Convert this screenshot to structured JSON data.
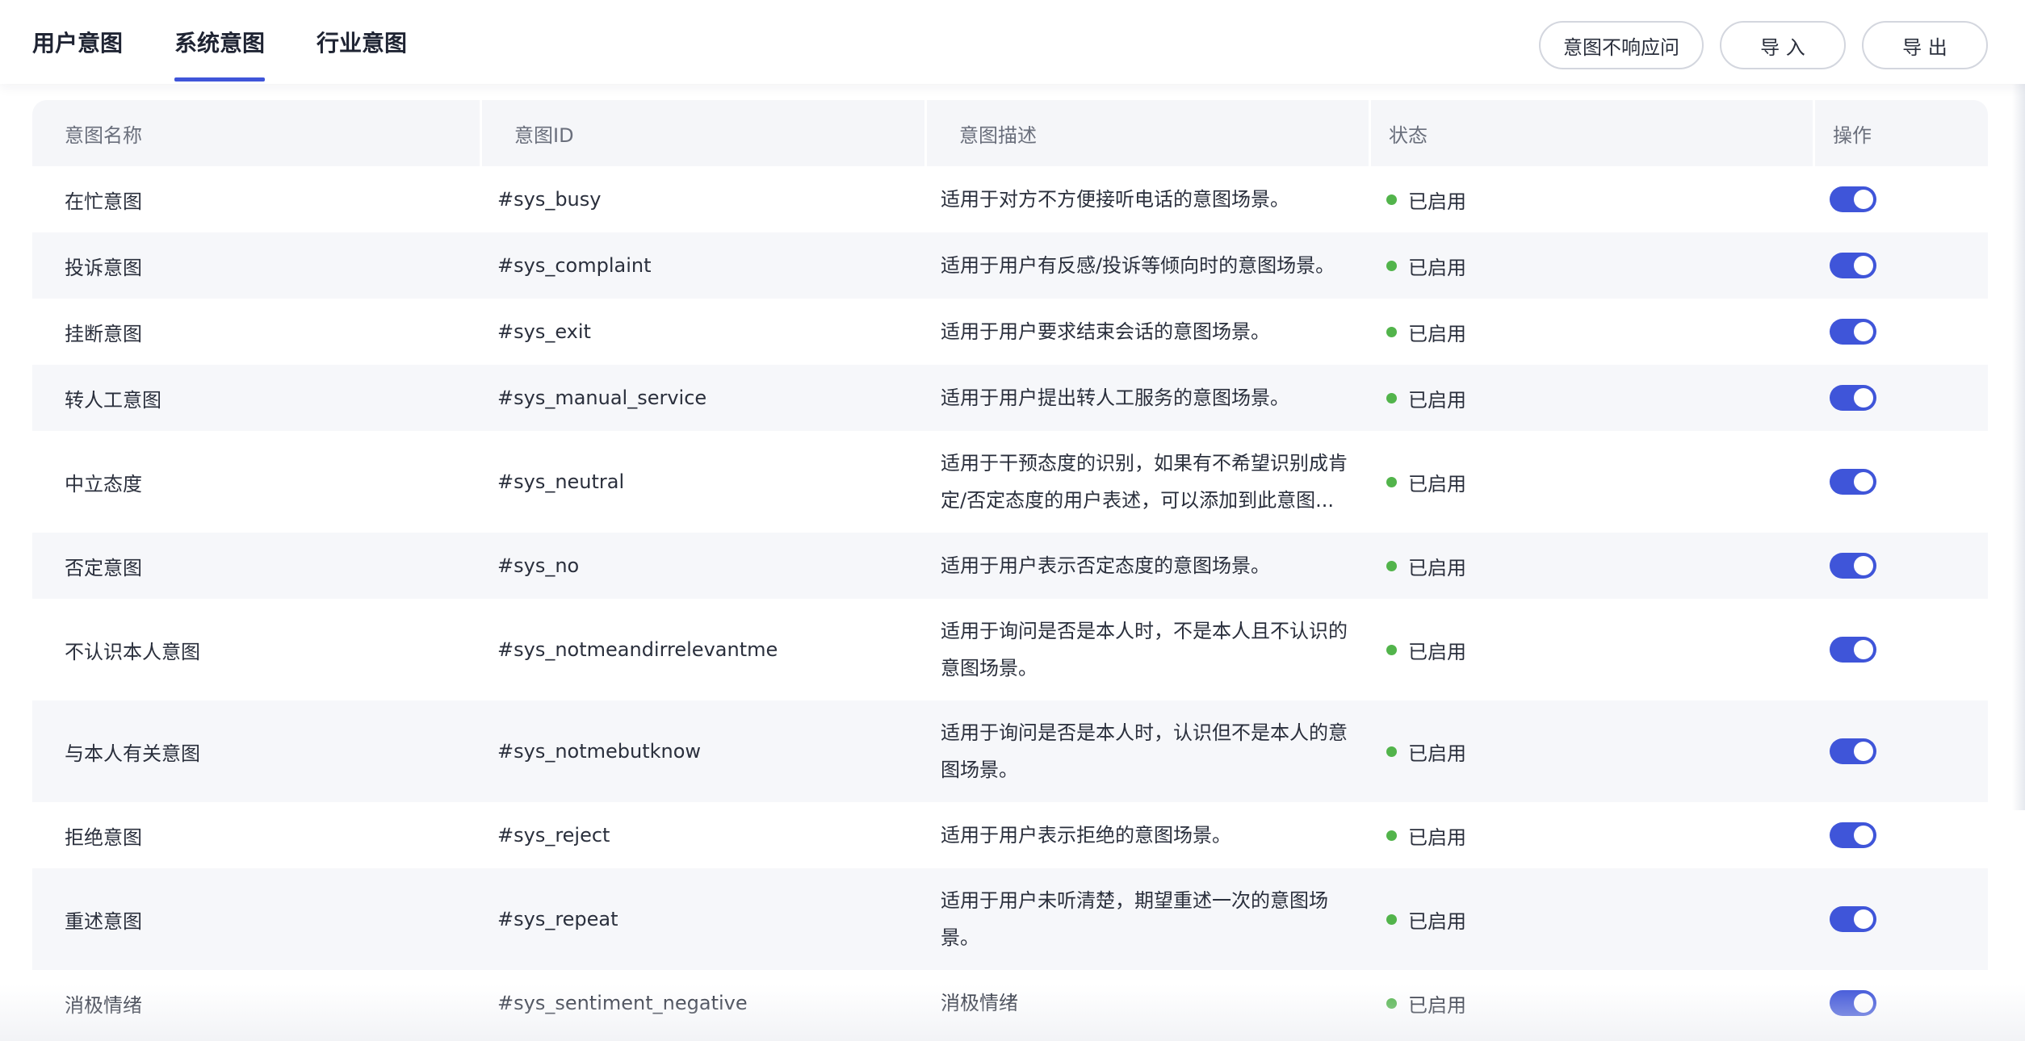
{
  "tabs": [
    {
      "label": "用户意图"
    },
    {
      "label": "系统意图"
    },
    {
      "label": "行业意图"
    }
  ],
  "actions": {
    "no_response": "意图不响应问",
    "import": "导 入",
    "export": "导 出"
  },
  "table": {
    "headers": [
      "意图名称",
      "意图ID",
      "意图描述",
      "状态",
      "操作"
    ],
    "rows": [
      {
        "name": "在忙意图",
        "id": "#sys_busy",
        "desc": "适用于对方不方便接听电话的意图场景。",
        "status": "已启用"
      },
      {
        "name": "投诉意图",
        "id": "#sys_complaint",
        "desc": "适用于用户有反感/投诉等倾向时的意图场景。",
        "status": "已启用"
      },
      {
        "name": "挂断意图",
        "id": "#sys_exit",
        "desc": "适用于用户要求结束会话的意图场景。",
        "status": "已启用"
      },
      {
        "name": "转人工意图",
        "id": "#sys_manual_service",
        "desc": "适用于用户提出转人工服务的意图场景。",
        "status": "已启用"
      },
      {
        "name": "中立态度",
        "id": "#sys_neutral",
        "desc": "适用于干预态度的识别，如果有不希望识别成肯定/否定态度的用户表述，可以添加到此意图...",
        "status": "已启用"
      },
      {
        "name": "否定意图",
        "id": "#sys_no",
        "desc": "适用于用户表示否定态度的意图场景。",
        "status": "已启用"
      },
      {
        "name": "不认识本人意图",
        "id": "#sys_notmeandirrelevantme",
        "desc": "适用于询问是否是本人时，不是本人且不认识的意图场景。",
        "status": "已启用"
      },
      {
        "name": "与本人有关意图",
        "id": "#sys_notmebutknow",
        "desc": "适用于询问是否是本人时，认识但不是本人的意图场景。",
        "status": "已启用"
      },
      {
        "name": "拒绝意图",
        "id": "#sys_reject",
        "desc": "适用于用户表示拒绝的意图场景。",
        "status": "已启用"
      },
      {
        "name": "重述意图",
        "id": "#sys_repeat",
        "desc": "适用于用户未听清楚，期望重述一次的意图场景。",
        "status": "已启用"
      },
      {
        "name": "消极情绪",
        "id": "#sys_sentiment_negative",
        "desc": "消极情绪",
        "status": "已启用"
      }
    ]
  },
  "colors": {
    "accent": "#3f55d9",
    "status_enabled": "#52b44b"
  },
  "icons": {
    "status": "status-dot-icon",
    "toggle": "toggle-switch"
  }
}
